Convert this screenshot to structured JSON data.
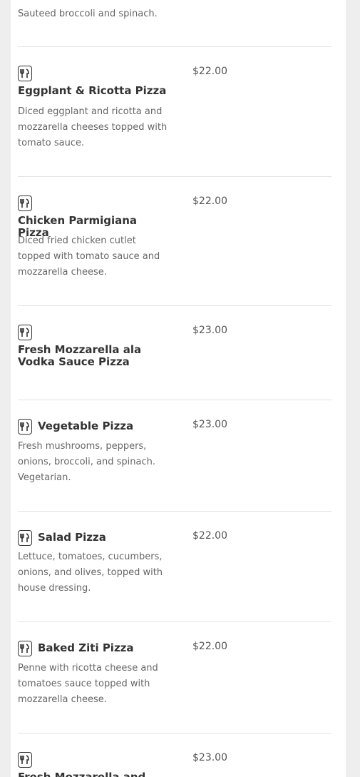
{
  "top_item": {
    "description": "Sauteed broccoli and spinach."
  },
  "items": [
    {
      "name": "Eggplant & Ricotta Pizza",
      "price": "$22.00",
      "description": "Diced eggplant and ricotta and mozzarella cheeses topped with tomato sauce."
    },
    {
      "name": "Chicken Parmigiana Pizza",
      "price": "$22.00",
      "description": "Diced fried chicken cutlet topped with tomato sauce and mozzarella cheese."
    },
    {
      "name": "Fresh Mozzarella ala Vodka Sauce Pizza",
      "price": "$23.00",
      "description": ""
    },
    {
      "name": "Vegetable Pizza",
      "price": "$23.00",
      "description": "Fresh mushrooms, peppers, onions, broccoli, and spinach. Vegetarian."
    },
    {
      "name": "Salad Pizza",
      "price": "$22.00",
      "description": "Lettuce, tomatoes, cucumbers, onions, and olives, topped with house dressing."
    },
    {
      "name": "Baked Ziti Pizza",
      "price": "$22.00",
      "description": "Penne with ricotta cheese and tomatoes sauce topped with mozzarella cheese."
    },
    {
      "name": "Fresh Mozzarella and",
      "price": "$23.00",
      "description": ""
    }
  ],
  "icons": {
    "menu_item": "fork-knife-icon"
  }
}
